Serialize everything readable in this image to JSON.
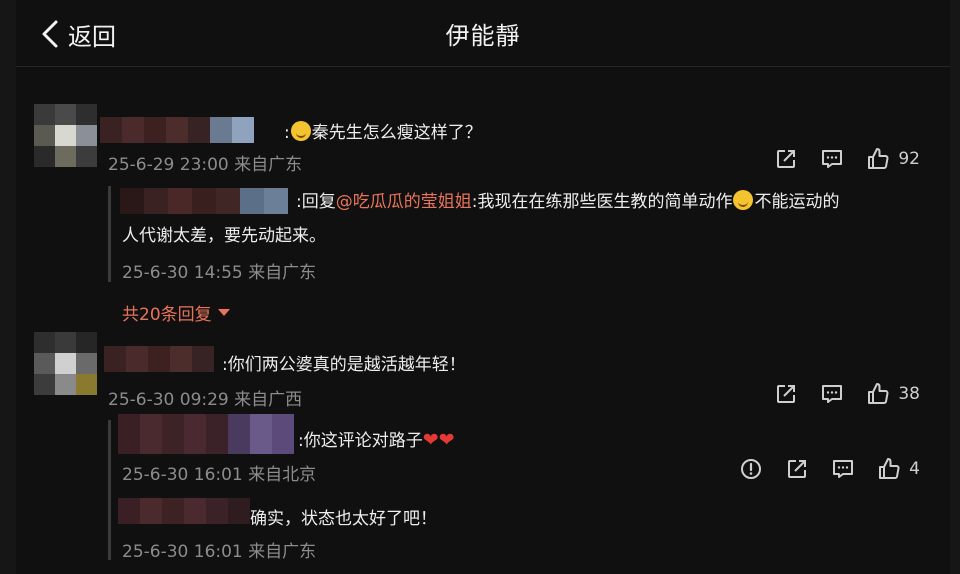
{
  "header": {
    "back_label": "返回",
    "title": "伊能靜"
  },
  "comments": [
    {
      "text": "秦先生怎么瘦这样了？",
      "meta": "25-6-29 23:00 来自广东",
      "likes": "92",
      "replies": [
        {
          "prefix": "回复",
          "mention": "@吃瓜瓜的莹姐姐",
          "line1": "我现在在练那些医生教的简单动作",
          "line1b": "不能运动的",
          "line2": "人代谢太差，要先动起来。",
          "meta": "25-6-30 14:55 来自广东"
        }
      ],
      "more_replies": "共20条回复"
    },
    {
      "text": "你们两公婆真的是越活越年轻！",
      "meta": "25-6-30 09:29 来自广西",
      "likes": "38",
      "replies": [
        {
          "text": "你这评论对路子",
          "hearts": "❤❤",
          "meta": "25-6-30 16:01 来自北京",
          "likes": "4"
        },
        {
          "text": "确实，状态也太好了吧！",
          "meta": "25-6-30 16:01 来自广东"
        }
      ]
    }
  ],
  "icons": {
    "share": "share-icon",
    "comment": "comment-icon",
    "like": "thumbs-up-icon",
    "report": "report-icon",
    "back": "chevron-left-icon"
  }
}
